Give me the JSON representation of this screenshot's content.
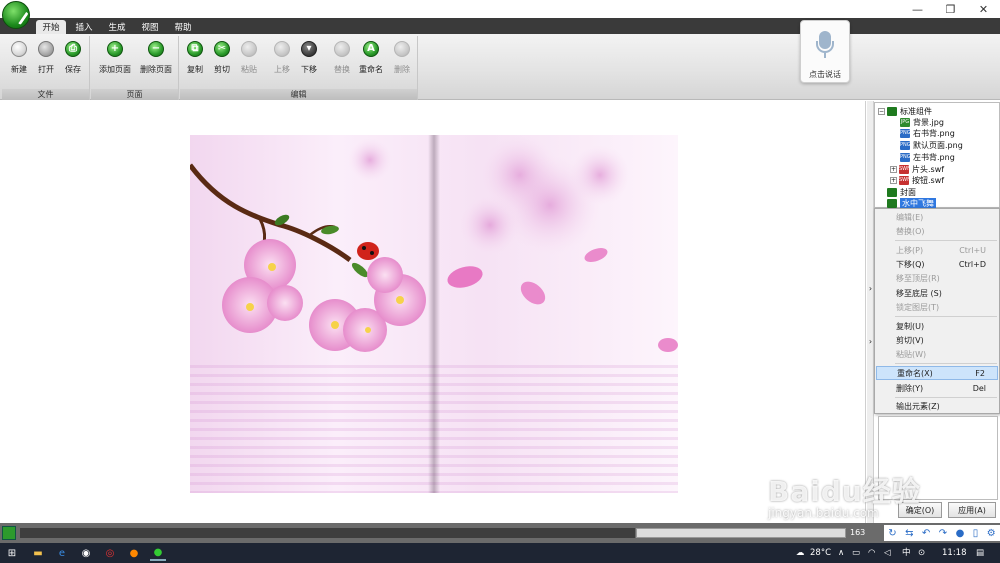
{
  "window": {
    "minimize": "—",
    "maximize": "❐",
    "close": "✕"
  },
  "tabs": [
    {
      "label": "开始"
    },
    {
      "label": "插入"
    },
    {
      "label": "生成"
    },
    {
      "label": "视图"
    },
    {
      "label": "帮助"
    }
  ],
  "ribbon": {
    "groups": [
      {
        "label": "文件",
        "buttons": [
          {
            "label": "新建"
          },
          {
            "label": "打开"
          },
          {
            "label": "保存"
          }
        ]
      },
      {
        "label": "页面",
        "buttons": [
          {
            "label": "添加页面"
          },
          {
            "label": "删除页面"
          }
        ]
      },
      {
        "label": "编辑",
        "buttons": [
          {
            "label": "复制"
          },
          {
            "label": "剪切"
          },
          {
            "label": "粘贴"
          },
          {
            "label": "上移"
          },
          {
            "label": "下移"
          },
          {
            "label": "替换"
          },
          {
            "label": "重命名"
          },
          {
            "label": "删除"
          }
        ]
      }
    ]
  },
  "voice": {
    "label": "点击说话"
  },
  "tree": {
    "nodes": [
      {
        "label": "标准组件"
      },
      {
        "label": "背景.jpg",
        "type": "JPG"
      },
      {
        "label": "右书背.png",
        "type": "PNG"
      },
      {
        "label": "默认页面.png",
        "type": "PNG"
      },
      {
        "label": "左书背.png",
        "type": "PNG"
      },
      {
        "label": "片头.swf",
        "type": "SWF"
      },
      {
        "label": "按钮.swf",
        "type": "SWF"
      },
      {
        "label": "封面"
      },
      {
        "label": "水中飞舞"
      }
    ]
  },
  "context_menu": {
    "items": [
      {
        "label": "编辑(E)",
        "shortcut": ""
      },
      {
        "label": "替换(O)",
        "shortcut": ""
      },
      {
        "label": "上移(P)",
        "shortcut": "Ctrl+U"
      },
      {
        "label": "下移(Q)",
        "shortcut": "Ctrl+D"
      },
      {
        "label": "移至顶层(R)",
        "shortcut": ""
      },
      {
        "label": "移至底层 (S)",
        "shortcut": ""
      },
      {
        "label": "锁定图层(T)",
        "shortcut": ""
      },
      {
        "label": "复制(U)",
        "shortcut": ""
      },
      {
        "label": "剪切(V)",
        "shortcut": ""
      },
      {
        "label": "粘贴(W)",
        "shortcut": ""
      },
      {
        "label": "重命名(X)",
        "shortcut": "F2"
      },
      {
        "label": "删除(Y)",
        "shortcut": "Del"
      },
      {
        "label": "输出元素(Z)",
        "shortcut": ""
      }
    ]
  },
  "properties": {
    "confirm_label": "确定(O)",
    "apply_label": "应用(A)"
  },
  "statusbar": {
    "zoom": "163"
  },
  "taskbar": {
    "weather": "28°C",
    "time": "11:18",
    "lang": "中"
  },
  "watermark": {
    "main": "Baidu经验",
    "sub": "jingyan.baidu.com"
  },
  "colors": {
    "accent": "#3078e0",
    "tabbar": "#3a3a3a",
    "brand_green": "#2a9a2a",
    "taskbar": "#1e2533"
  }
}
